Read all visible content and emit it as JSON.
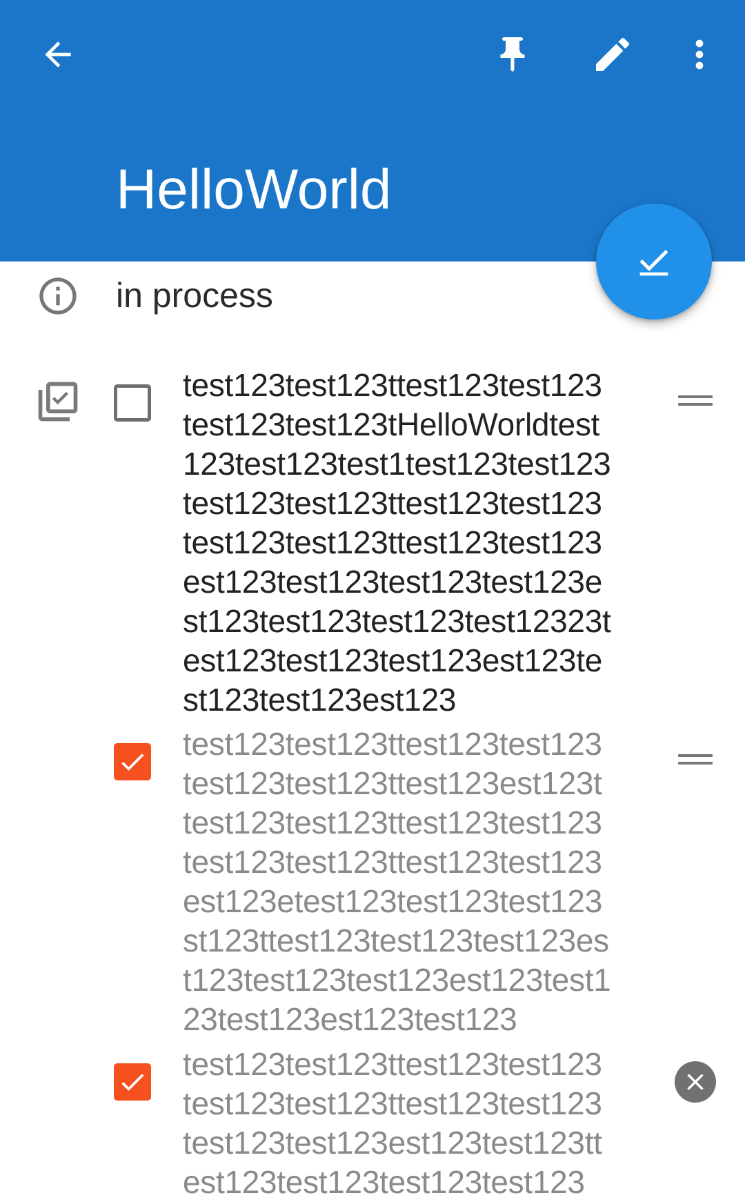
{
  "app_bar": {
    "title": "HelloWorld",
    "color": "#1b76c9",
    "actions": [
      "back-arrow-icon",
      "pin-icon",
      "edit-pencil-icon",
      "more-vert-icon"
    ]
  },
  "fab": {
    "icon": "done-check-icon",
    "color": "#2190e8"
  },
  "status": {
    "icon": "info-icon",
    "text": "in process"
  },
  "checklist": {
    "mode_icon": "checklist-mode-icon",
    "accent": "#f4511e",
    "items": [
      {
        "checked": false,
        "text": "test123test123ttest123test123\ntest123test123tHelloWorldtest\n123test123test1test123test123\ntest123test123ttest123test123\ntest123test123ttest123test123\nest123test123test123test123e\nst123test123test123test12323t\nest123test123test123est123te\nst123test123est123",
        "trailing": "drag-handle-icon"
      },
      {
        "checked": true,
        "text": "test123test123ttest123test123\ntest123test123ttest123est123t\ntest123test123ttest123test123\ntest123test123ttest123test123\nest123etest123test123test123\nst123ttest123test123test123es\nt123test123test123est123test1\n23test123est123test123",
        "trailing": "drag-handle-icon"
      },
      {
        "checked": true,
        "text": "test123test123ttest123test123\ntest123test123ttest123test123\ntest123test123est123test123tt\nest123test123test123test123",
        "trailing": "clear-icon"
      }
    ]
  }
}
